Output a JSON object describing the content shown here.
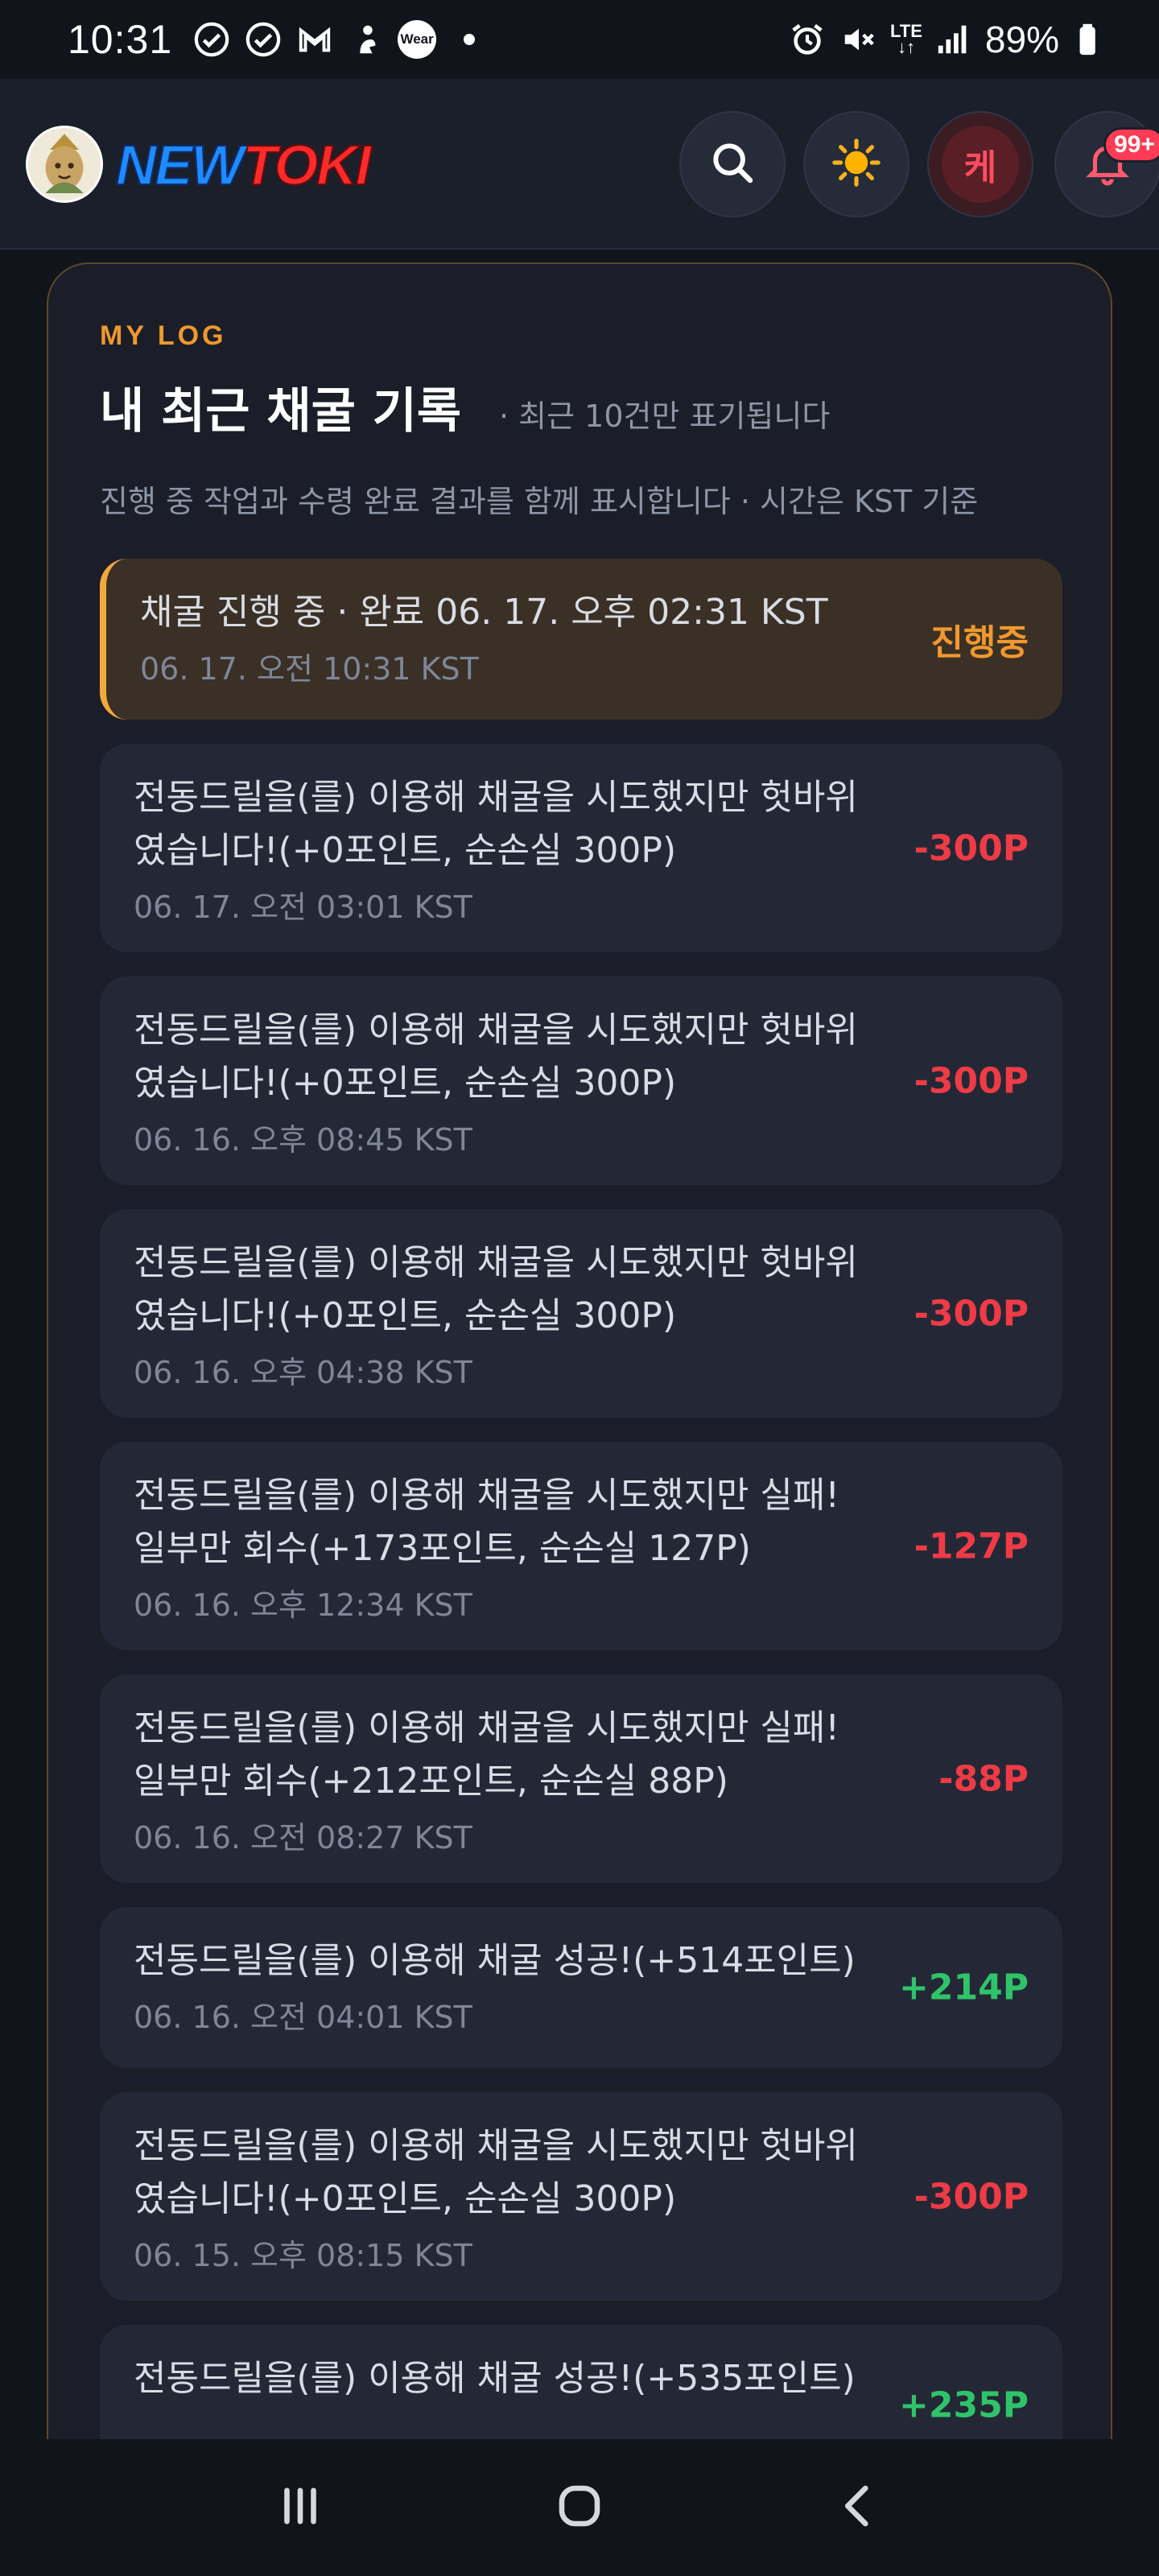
{
  "status_bar": {
    "time": "10:31",
    "wear_label": "Wear",
    "network": "LTE",
    "battery": "89%"
  },
  "header": {
    "logo_part1": "NEW",
    "logo_part2": "TOKI",
    "user_initial": "케",
    "notification_badge": "99+",
    "icons": [
      "search-icon",
      "sun-icon",
      "bell-icon"
    ]
  },
  "log": {
    "eyebrow": "MY LOG",
    "title": "내 최근 채굴 기록",
    "subnote": "· 최근 10건만 표기됩니다",
    "description": "진행 중 작업과 수령 완료 결과를 함께 표시합니다 · 시간은 KST 기준",
    "items": [
      {
        "message": "채굴 진행 중 · 완료 06. 17. 오후 02:31 KST",
        "time": "06. 17. 오전 10:31 KST",
        "delta": "진행중",
        "kind": "prog"
      },
      {
        "message": "전동드릴을(를) 이용해 채굴을 시도했지만 헛바위였습니다!(+0포인트, 순손실 300P)",
        "time": "06. 17. 오전 03:01 KST",
        "delta": "-300P",
        "kind": "neg"
      },
      {
        "message": "전동드릴을(를) 이용해 채굴을 시도했지만 헛바위였습니다!(+0포인트, 순손실 300P)",
        "time": "06. 16. 오후 08:45 KST",
        "delta": "-300P",
        "kind": "neg"
      },
      {
        "message": "전동드릴을(를) 이용해 채굴을 시도했지만 헛바위였습니다!(+0포인트, 순손실 300P)",
        "time": "06. 16. 오후 04:38 KST",
        "delta": "-300P",
        "kind": "neg"
      },
      {
        "message": "전동드릴을(를) 이용해 채굴을 시도했지만 실패! 일부만 회수(+173포인트, 순손실 127P)",
        "time": "06. 16. 오후 12:34 KST",
        "delta": "-127P",
        "kind": "neg"
      },
      {
        "message": "전동드릴을(를) 이용해 채굴을 시도했지만 실패! 일부만 회수(+212포인트, 순손실 88P)",
        "time": "06. 16. 오전 08:27 KST",
        "delta": "-88P",
        "kind": "neg"
      },
      {
        "message": "전동드릴을(를) 이용해 채굴 성공!(+514포인트)",
        "time": "06. 16. 오전 04:01 KST",
        "delta": "+214P",
        "kind": "pos"
      },
      {
        "message": "전동드릴을(를) 이용해 채굴을 시도했지만 헛바위였습니다!(+0포인트, 순손실 300P)",
        "time": "06. 15. 오후 08:15 KST",
        "delta": "-300P",
        "kind": "neg"
      },
      {
        "message": "전동드릴을(를) 이용해 채굴 성공!(+535포인트)",
        "time": "",
        "delta": "+235P",
        "kind": "pos"
      }
    ]
  },
  "colors": {
    "accent": "#f0982f",
    "negative": "#ef3b46",
    "positive": "#2fc46a",
    "card_bg": "#1b1e28",
    "page_bg": "#12141b"
  }
}
